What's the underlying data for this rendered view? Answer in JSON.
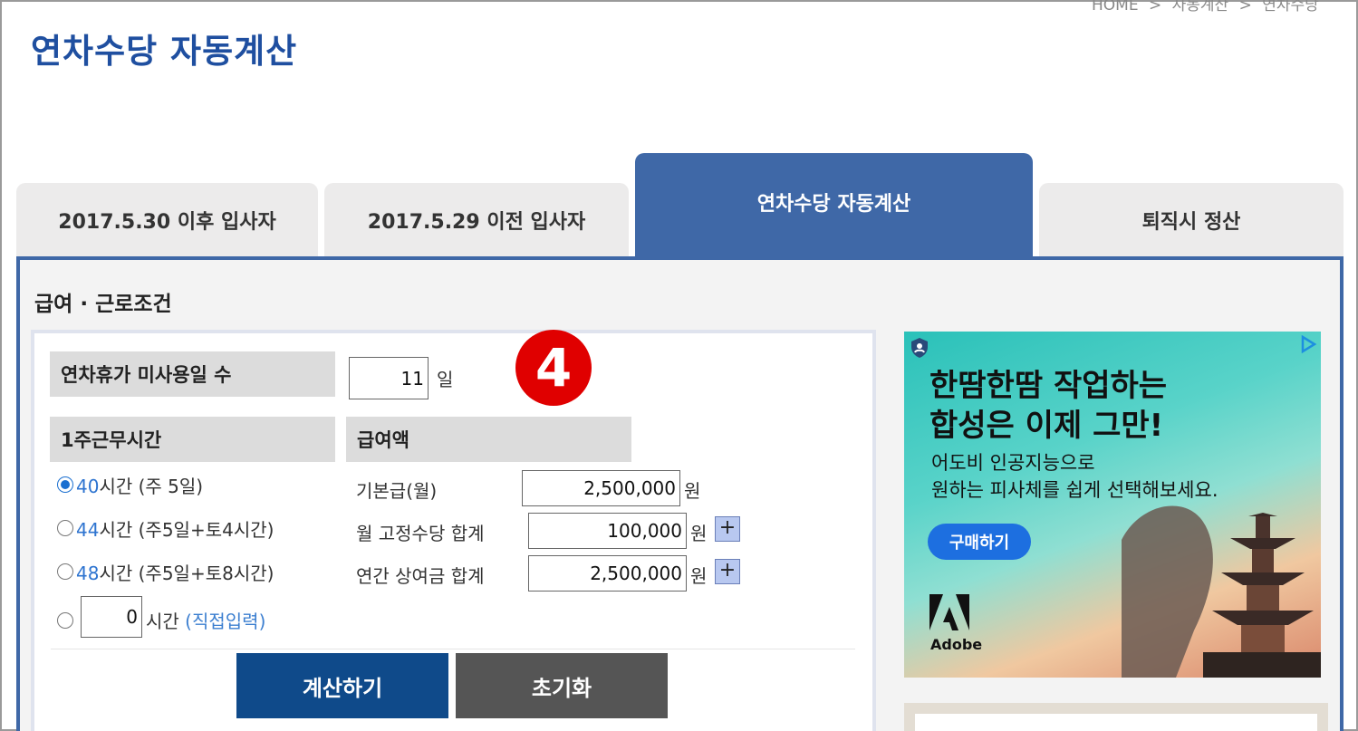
{
  "breadcrumb": [
    "HOME",
    ">",
    "자동계산",
    ">",
    "연차수당"
  ],
  "page_title": "연차수당 자동계산",
  "tabs": [
    {
      "label": "2017.5.30 이후 입사자",
      "active": false
    },
    {
      "label": "2017.5.29 이전 입사자",
      "active": false
    },
    {
      "label": "연차수당 자동계산",
      "active": true
    },
    {
      "label": "퇴직시 정산",
      "active": false
    }
  ],
  "section_title": "급여 · 근로조건",
  "unused_leave": {
    "label": "연차휴가 미사용일 수",
    "value": "11",
    "unit": "일"
  },
  "weekly_hours": {
    "label": "1주근무시간",
    "options": [
      {
        "hours": "40",
        "text": "시간 (주 5일)",
        "checked": true
      },
      {
        "hours": "44",
        "text": "시간 (주5일+토4시간)",
        "checked": false
      },
      {
        "hours": "48",
        "text": "시간 (주5일+토8시간)",
        "checked": false
      }
    ],
    "custom": {
      "value": "0",
      "text": "시간",
      "hint": "(직접입력)"
    }
  },
  "salary": {
    "label": "급여액",
    "fields": [
      {
        "label": "기본급(월)",
        "value": "2,500,000",
        "unit": "원"
      },
      {
        "label": "월 고정수당 합계",
        "value": "100,000",
        "unit": "원",
        "plus": "+"
      },
      {
        "label": "연간 상여금 합계",
        "value": "2,500,000",
        "unit": "원",
        "plus": "+"
      }
    ]
  },
  "buttons": {
    "calculate": "계산하기",
    "reset": "초기화"
  },
  "step_badge": "4",
  "ad": {
    "headline_1": "한땀한땀 작업하는",
    "headline_2": "합성은 이제 그만!",
    "sub_1": "어도비 인공지능으로",
    "sub_2": "원하는 피사체를 쉽게 선택해보세요.",
    "cta": "구매하기",
    "brand": "Adobe"
  },
  "colors": {
    "accent": "#3f68a7",
    "title": "#1f4fa0",
    "calc_button": "#0f4a8a",
    "reset_button": "#555555",
    "badge": "#e00000"
  }
}
